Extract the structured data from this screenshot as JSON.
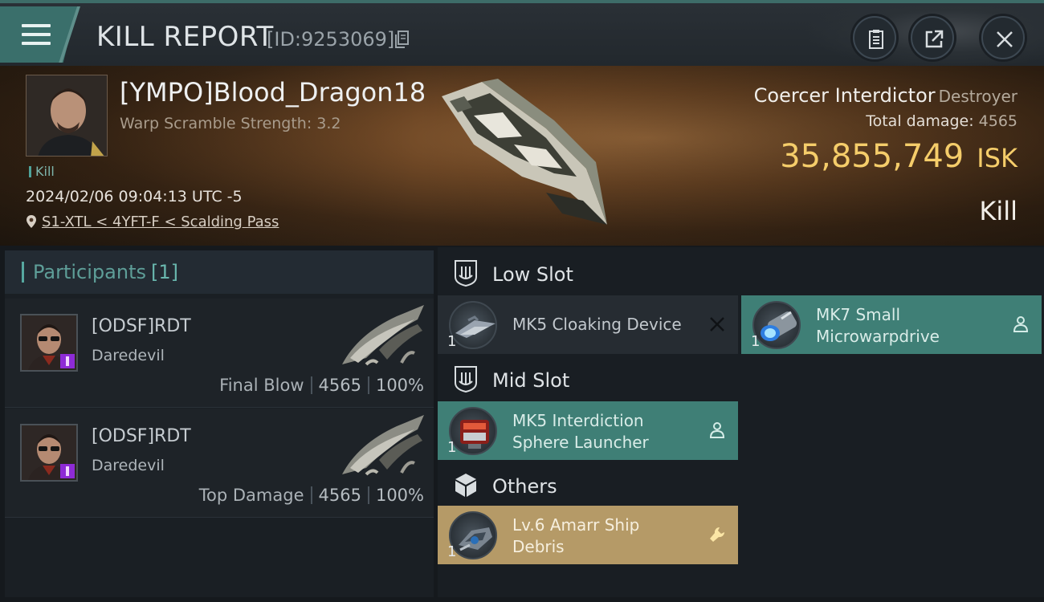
{
  "header": {
    "title": "KILL REPORT",
    "report_id": "[ID:9253069]"
  },
  "victim": {
    "name": "[YMPO]Blood_Dragon18",
    "warp_scramble": "Warp Scramble Strength: 3.2",
    "tag": "Kill",
    "datetime": "2024/02/06 09:04:13 UTC -5",
    "location": "S1-XTL < 4YFT-F < Scalding Pass",
    "ship_name": "Coercer Interdictor",
    "ship_class": "Destroyer",
    "total_damage_label": "Total damage:",
    "total_damage": "4565",
    "isk_value": "35,855,749",
    "isk_unit": "ISK",
    "result": "Kill"
  },
  "participants": {
    "title": "Participants",
    "count": "[1]",
    "rows": [
      {
        "name": "[ODSF]RDT",
        "ship": "Daredevil",
        "label": "Final Blow",
        "damage": "4565",
        "percent": "100%"
      },
      {
        "name": "[ODSF]RDT",
        "ship": "Daredevil",
        "label": "Top Damage",
        "damage": "4565",
        "percent": "100%"
      }
    ]
  },
  "fitting": {
    "low_slot": {
      "title": "Low Slot",
      "items": [
        {
          "qty": "1",
          "name_line1": "MK5 Cloaking Device",
          "name_line2": ""
        },
        {
          "qty": "1",
          "name_line1": "MK7 Small",
          "name_line2": "Microwarpdrive"
        }
      ]
    },
    "mid_slot": {
      "title": "Mid Slot",
      "items": [
        {
          "qty": "1",
          "name_line1": "MK5 Interdiction",
          "name_line2": "Sphere Launcher"
        }
      ]
    },
    "others": {
      "title": "Others",
      "items": [
        {
          "qty": "1",
          "name_line1": "Lv.6 Amarr Ship",
          "name_line2": "Debris"
        }
      ]
    }
  },
  "colors": {
    "accent_teal": "#3f7f76",
    "isk_gold": "#f5cd6a",
    "loot_gold": "#b59a67"
  }
}
